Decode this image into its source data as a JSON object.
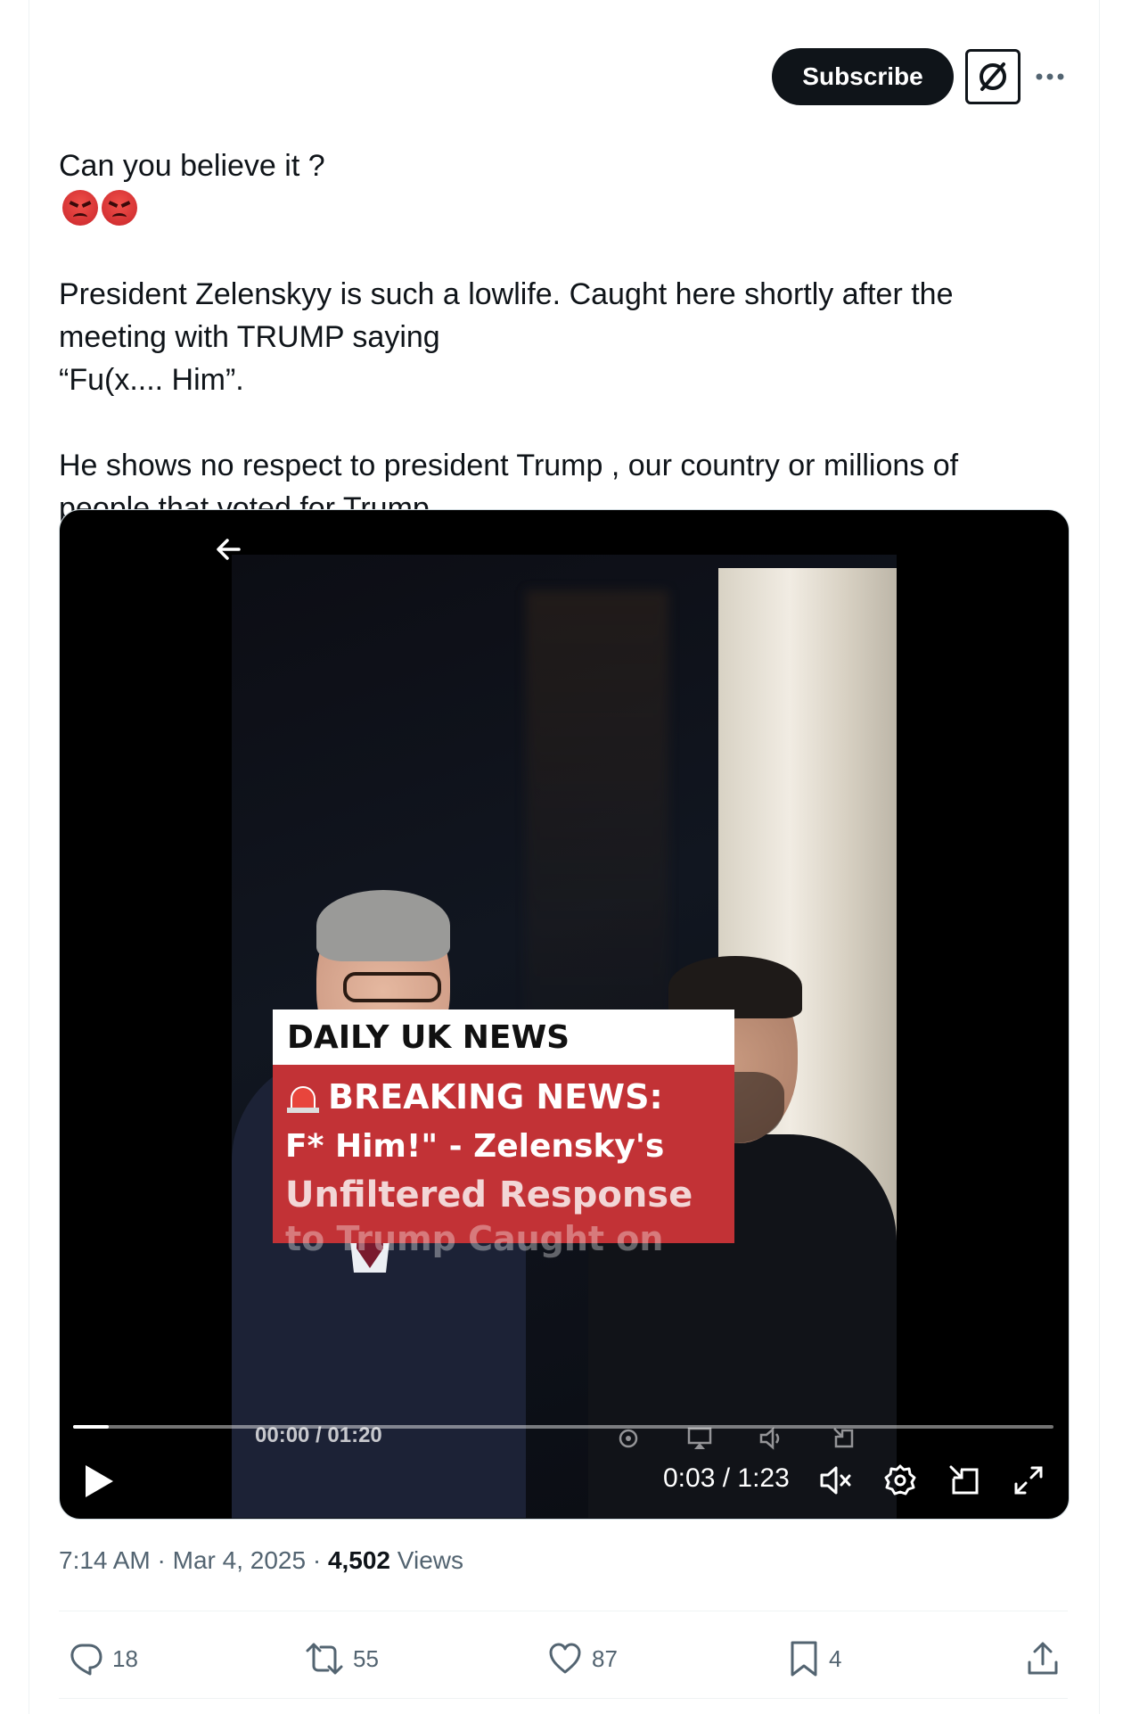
{
  "header": {
    "subscribe_label": "Subscribe",
    "grok_icon": "grok-icon",
    "more_icon": "more-icon"
  },
  "tweet": {
    "line1": "Can you believe it ?",
    "emoji": "angry-face x2",
    "paragraph2": "President Zelenskyy is such a lowlife. Caught here shortly after the\nmeeting with TRUMP saying\n“Fu(x.... Him”.",
    "paragraph3": "He shows no respect  to president Trump , our country or millions of\npeople that voted for Trump."
  },
  "video": {
    "overlay_header": "DAILY UK NEWS",
    "overlay_line1": "BREAKING NEWS:",
    "overlay_line2": "F* Him!\" - Zelensky's",
    "overlay_line3": "Unfiltered Response",
    "overlay_line4": "to Trump Caught on",
    "ghost_time": "00:00 / 01:20",
    "current_time": "0:03 / 1:23",
    "progress": 0.036,
    "icons": [
      "back-arrow-icon",
      "play-icon",
      "mute-icon",
      "settings-icon",
      "pip-icon",
      "fullscreen-icon"
    ]
  },
  "meta": {
    "time": "7:14 AM",
    "separator": "·",
    "date": "Mar 4, 2025",
    "views_count": "4,502",
    "views_label": "Views"
  },
  "actions": {
    "replies": "18",
    "reposts": "55",
    "likes": "87",
    "bookmarks": "4"
  },
  "colors": {
    "text": "#0f1419",
    "secondary": "#536471",
    "border": "#eff3f4",
    "news_red": "#c23236"
  }
}
